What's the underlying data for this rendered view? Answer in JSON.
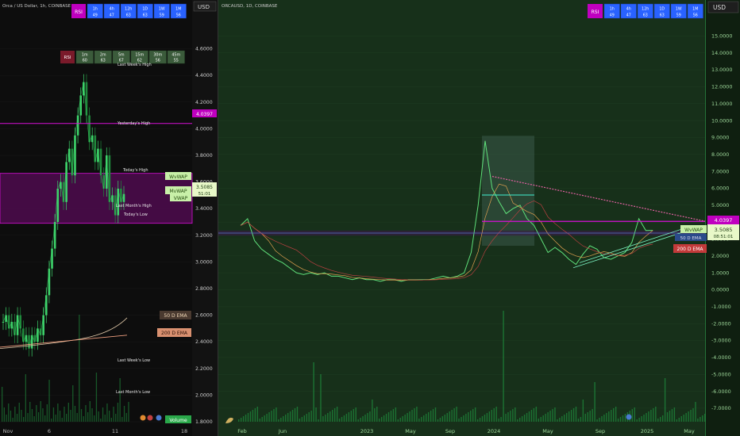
{
  "colors": {
    "left_bg": "#0d0d0d",
    "right_bg": "#17301a",
    "up": "#3dd36a",
    "down": "#1f8a3c",
    "magenta": "#d60fd6",
    "purple_zone": "#4a0b4a",
    "rsi_badge": "#c000c0",
    "tf_cell": "#2962ff",
    "tf_cell_green": "#3b5b3b",
    "ema50": "#e0c8a8",
    "ema200": "#f0a080",
    "vwap_fill": "#e8f8c8",
    "ema_red": "#c33a3a",
    "wvwap_fill": "#c8f0a8"
  },
  "left_panel": {
    "title": "Orca / US Dollar, 1h, COINBASE",
    "axis_label": "USD",
    "rsi_top": {
      "badge": "RSI",
      "cells": [
        {
          "tf": "1h",
          "val": "49"
        },
        {
          "tf": "4h",
          "val": "47"
        },
        {
          "tf": "12h",
          "val": "63"
        },
        {
          "tf": "1D",
          "val": "63"
        },
        {
          "tf": "1W",
          "val": "59"
        },
        {
          "tf": "1M",
          "val": "56"
        }
      ]
    },
    "rsi_mid": {
      "badge": "RSI",
      "cells": [
        {
          "tf": "1m",
          "val": "60"
        },
        {
          "tf": "2m",
          "val": "63"
        },
        {
          "tf": "5m",
          "val": "67"
        },
        {
          "tf": "15m",
          "val": "62"
        },
        {
          "tf": "30m",
          "val": "56"
        },
        {
          "tf": "45m",
          "val": "55"
        }
      ]
    },
    "labels": {
      "last_week_high": "Last Week's High",
      "yesterday_high": "Yesterday's High",
      "today_high": "Today's High",
      "last_month_high": "Last Month's High",
      "today_low": "Today's Low",
      "last_week_low": "Last Week's Low",
      "last_month_low": "Last Month's Low"
    },
    "tags": {
      "price_magenta": "4.0397",
      "wvwap": "WvWAP",
      "mvwap": "MvWAP",
      "price": "3.5085",
      "countdown": "51:01",
      "vwap": "VWAP",
      "ema50": "50 D EMA",
      "ema200": "200 D EMA",
      "volume": "Volume"
    }
  },
  "right_panel": {
    "title": "ORCAUSD, 1D, COINBASE",
    "axis_label": "USD",
    "rsi_top": {
      "badge": "RSI",
      "cells": [
        {
          "tf": "1h",
          "val": "49"
        },
        {
          "tf": "4h",
          "val": "47"
        },
        {
          "tf": "12h",
          "val": "63"
        },
        {
          "tf": "1D",
          "val": "63"
        },
        {
          "tf": "1W",
          "val": "59"
        },
        {
          "tf": "1M",
          "val": "56"
        }
      ]
    },
    "tags": {
      "price_magenta": "4.0397",
      "wvwap": "WvWAP",
      "price": "3.5085",
      "ema_small": "50 D EMA",
      "countdown": "08:51:01",
      "ema200": "200 D EMA"
    }
  },
  "chart_data": [
    {
      "type": "line",
      "title": "Orca / US Dollar, 1h, COINBASE",
      "ylabel": "USD",
      "ylim": [
        1.8,
        4.8
      ],
      "yticks": [
        "4.6000",
        "4.4000",
        "4.2000",
        "4.0000",
        "3.8000",
        "3.6000",
        "3.4000",
        "3.2000",
        "3.0000",
        "2.8000",
        "2.6000",
        "2.4000",
        "2.2000",
        "2.0000",
        "1.8000"
      ],
      "ytick_values": [
        4.6,
        4.4,
        4.2,
        4.0,
        3.8,
        3.6,
        3.4,
        3.2,
        3.0,
        2.8,
        2.6,
        2.4,
        2.2,
        2.0,
        1.8
      ],
      "xticks": [
        "Nov",
        "6",
        "11",
        "18"
      ],
      "series": [
        {
          "x": [
            0,
            4,
            8,
            12,
            16,
            20,
            24,
            28,
            32,
            36,
            40,
            44,
            48,
            52,
            56,
            60,
            64,
            68,
            72,
            76,
            80,
            84,
            88,
            92,
            96,
            100,
            104,
            108,
            112,
            116,
            120,
            124,
            128,
            132,
            136,
            140,
            144,
            148,
            152,
            156,
            160,
            164,
            168
          ],
          "values": [
            2.55,
            2.6,
            2.5,
            2.55,
            2.45,
            2.6,
            2.5,
            2.4,
            2.45,
            2.35,
            2.45,
            2.4,
            2.5,
            2.45,
            2.6,
            2.75,
            2.95,
            3.1,
            3.3,
            3.55,
            3.6,
            3.45,
            3.75,
            3.85,
            3.65,
            3.95,
            4.1,
            4.25,
            4.35,
            4.1,
            3.9,
            3.95,
            3.75,
            3.85,
            3.65,
            3.55,
            3.8,
            3.45,
            3.5,
            3.35,
            3.55,
            3.45,
            3.51
          ]
        }
      ],
      "levels": {
        "magenta_line": 4.0397,
        "zone_top": 3.665,
        "zone_bottom": 3.29,
        "ema50_end": 2.58,
        "ema200_end": 2.45
      }
    },
    {
      "type": "line",
      "title": "ORCAUSD, 1D, COINBASE",
      "ylabel": "USD",
      "ylim": [
        -7.8,
        16
      ],
      "yticks": [
        "15.0000",
        "14.0000",
        "13.0000",
        "12.0000",
        "11.0000",
        "10.0000",
        "9.0000",
        "8.0000",
        "7.0000",
        "6.0000",
        "5.0000",
        "4.0000",
        "3.0000",
        "2.0000",
        "1.0000",
        "0.0000",
        "-1.0000",
        "-2.0000",
        "-3.0000",
        "-4.0000",
        "-5.0000",
        "-6.0000",
        "-7.0000"
      ],
      "ytick_values": [
        15,
        14,
        13,
        12,
        11,
        10,
        9,
        8,
        7,
        6,
        5,
        4,
        3,
        2,
        1,
        0,
        -1,
        -2,
        -3,
        -4,
        -5,
        -6,
        -7
      ],
      "xticks": [
        "Feb",
        "Jun",
        "2023",
        "May",
        "Sep",
        "2024",
        "May",
        "Sep",
        "2025",
        "May"
      ],
      "series": [
        {
          "x": [
            0,
            15,
            30,
            45,
            60,
            75,
            90,
            105,
            120,
            135,
            150,
            165,
            180,
            195,
            210,
            225,
            240,
            255,
            270,
            285,
            300,
            315,
            330,
            345,
            360,
            375,
            390,
            405,
            420,
            435,
            450,
            465,
            480,
            495,
            510,
            525,
            540,
            555,
            570,
            585,
            600,
            615,
            630,
            645,
            660,
            675,
            690,
            705,
            720,
            735,
            750,
            765,
            780,
            795,
            810,
            825,
            840,
            855,
            870,
            885,
            900,
            915,
            930,
            945,
            960,
            975
          ],
          "values": [
            3.8,
            4.2,
            2.9,
            2.4,
            2.1,
            1.8,
            1.6,
            1.3,
            1.0,
            0.9,
            1.0,
            0.9,
            1.0,
            0.8,
            0.8,
            0.7,
            0.6,
            0.7,
            0.6,
            0.6,
            0.5,
            0.6,
            0.6,
            0.5,
            0.6,
            0.6,
            0.6,
            0.6,
            0.7,
            0.8,
            0.7,
            0.8,
            1.0,
            2.2,
            5.0,
            8.8,
            6.0,
            5.2,
            4.5,
            4.8,
            5.0,
            4.2,
            3.8,
            3.0,
            2.2,
            2.5,
            2.2,
            1.8,
            1.5,
            2.1,
            2.6,
            2.4,
            1.9,
            1.8,
            2.0,
            2.2,
            2.8,
            4.2,
            3.5,
            3.51,
            3.51,
            3.51,
            3.51,
            3.51,
            3.51,
            3.51
          ]
        }
      ],
      "levels": {
        "magenta_line": 4.0397,
        "blue_line": 3.35,
        "purple_band_top": 3.5,
        "purple_band_bottom": 3.2,
        "cyan_line": 5.6,
        "dotted_start": 6.7,
        "dotted_end": 4.05
      }
    }
  ]
}
